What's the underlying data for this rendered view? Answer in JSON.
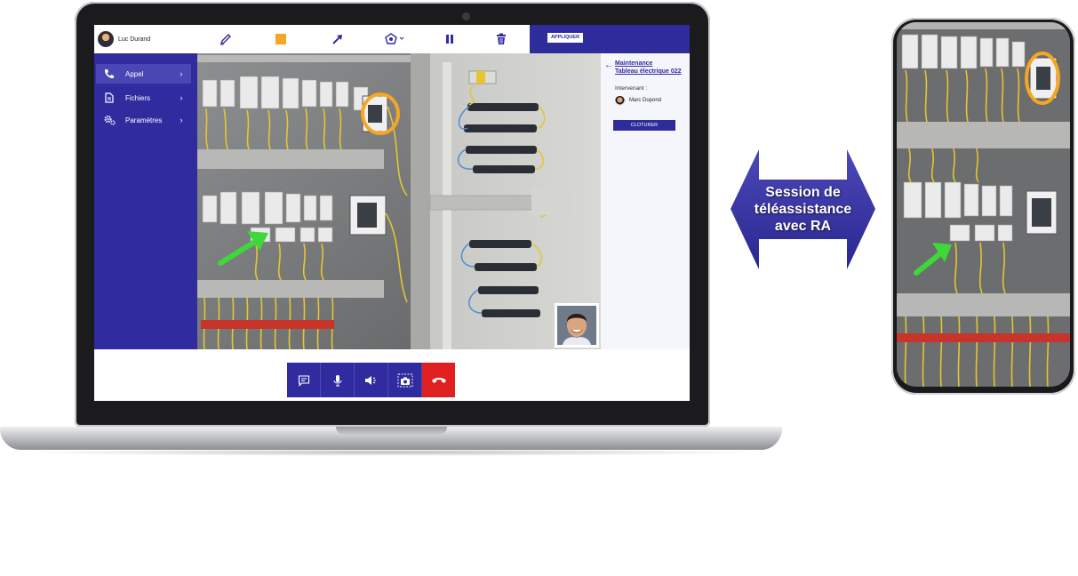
{
  "topbar": {
    "user_name": "Luc Durand",
    "apply_label": "APPLIQUER",
    "tools": [
      {
        "icon": "pen-icon"
      },
      {
        "icon": "square-icon",
        "color": "#f5a623"
      },
      {
        "icon": "arrow-icon"
      },
      {
        "icon": "shape-dropdown-icon"
      },
      {
        "icon": "pause-icon"
      },
      {
        "icon": "trash-icon"
      }
    ]
  },
  "sidebar": {
    "items": [
      {
        "label": "Appel",
        "icon": "phone-icon",
        "active": true
      },
      {
        "label": "Fichiers",
        "icon": "file-icon",
        "active": false
      },
      {
        "label": "Paramètres",
        "icon": "settings-icon",
        "active": false
      }
    ]
  },
  "panel": {
    "title_line1": "Maintenance",
    "title_line2": "Tableau électrique 022",
    "intervenant_label": "Intervenant :",
    "intervenant_name": "Marc Dupond",
    "close_label": "CLOTURER"
  },
  "call_controls": [
    {
      "icon": "chat-icon"
    },
    {
      "icon": "microphone-icon"
    },
    {
      "icon": "speaker-icon"
    },
    {
      "icon": "camera-icon"
    },
    {
      "icon": "hangup-icon"
    }
  ],
  "arrow_label": {
    "line1": "Session de",
    "line2": "téléassistance",
    "line3": "avec RA"
  },
  "colors": {
    "brand": "#302ca0",
    "end_call": "#e02020",
    "annotation_circle": "#f5a623",
    "annotation_arrow": "#3fd83a"
  }
}
